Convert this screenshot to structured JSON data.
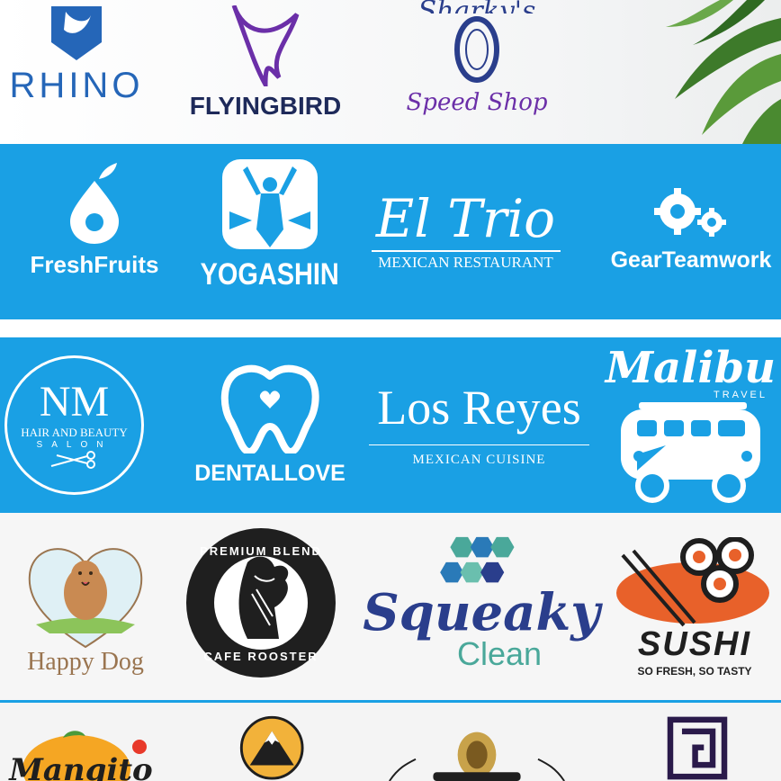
{
  "colors": {
    "blue_band": "#1aa0e4",
    "navy": "#1e2a5a",
    "rhino_blue": "#2566b8",
    "purple": "#6b2fa8",
    "squeaky_navy": "#2a3e8c",
    "squeaky_teal": "#4aa89a",
    "sushi_orange": "#e8612a",
    "happy_dog_brown": "#9a7550"
  },
  "row1": {
    "rhino": {
      "name": "RHINO",
      "icon": "rhino-shield-icon"
    },
    "flyingbird": {
      "name": "FLYINGBIRD",
      "icon": "bird-icon"
    },
    "sharkys": {
      "top": "Sharky's",
      "bottom": "Speed Shop",
      "icon": "shark-jaw-icon"
    }
  },
  "row2": {
    "freshfruits": {
      "name": "FreshFruits",
      "icon": "fruit-drop-icon"
    },
    "yogashin": {
      "name": "YOGASHIN",
      "icon": "yoga-figure-icon"
    },
    "eltrio": {
      "name": "El Trio",
      "sub": "MEXICAN RESTAURANT"
    },
    "gearteam": {
      "name": "GearTeamwork",
      "icon": "gears-icon"
    }
  },
  "row3": {
    "nm": {
      "initials": "NM",
      "line1": "HAIR AND BEAUTY",
      "line2": "SALON",
      "icon": "scissors-icon"
    },
    "dentallove": {
      "name": "DENTALLOVE",
      "icon": "tooth-heart-icon"
    },
    "losreyes": {
      "name": "Los Reyes",
      "sub": "MEXICAN CUISINE"
    },
    "malibu": {
      "name": "Malibu",
      "sub": "TRAVEL",
      "icon": "van-icon"
    }
  },
  "row4": {
    "happydog": {
      "name": "Happy Dog",
      "icon": "dog-heart-icon"
    },
    "rooster": {
      "top": "PREMIUM BLEND",
      "bottom": "CAFE ROOSTER",
      "icon": "rooster-icon"
    },
    "squeaky": {
      "name": "Squeaky",
      "sub": "Clean",
      "icon": "hexagon-cluster-icon"
    },
    "sushi": {
      "name": "SUSHI",
      "sub": "SO FRESH, SO TASTY",
      "icon": "sushi-rolls-icon"
    }
  },
  "row5": {
    "mangito": {
      "name": "Mangito",
      "icon": "mango-icon"
    },
    "mountain": {
      "icon": "mountain-badge-icon"
    },
    "trumpet": {
      "icon": "trumpet-icon"
    },
    "square": {
      "icon": "square-maze-icon"
    }
  }
}
